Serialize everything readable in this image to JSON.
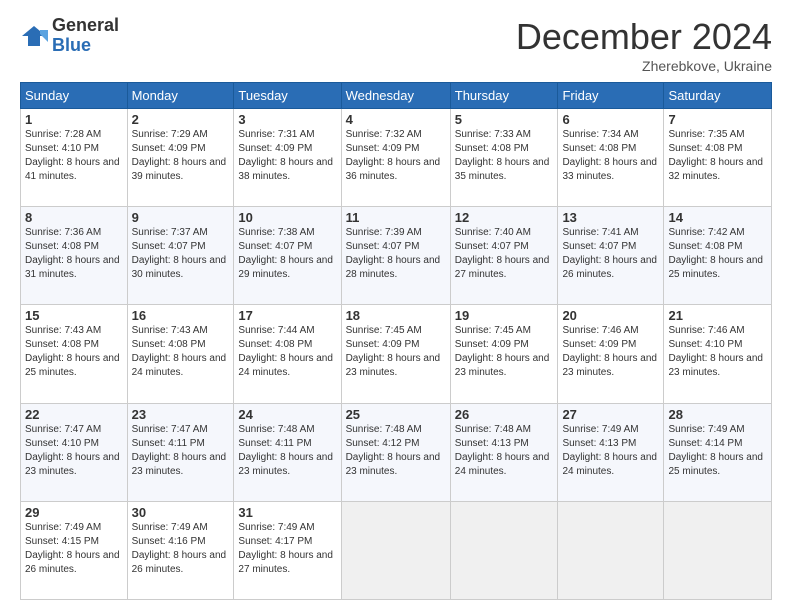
{
  "logo": {
    "general": "General",
    "blue": "Blue"
  },
  "title": "December 2024",
  "subtitle": "Zherebkove, Ukraine",
  "days_header": [
    "Sunday",
    "Monday",
    "Tuesday",
    "Wednesday",
    "Thursday",
    "Friday",
    "Saturday"
  ],
  "weeks": [
    [
      {
        "day": "1",
        "sunrise": "7:28 AM",
        "sunset": "4:10 PM",
        "daylight": "8 hours and 41 minutes."
      },
      {
        "day": "2",
        "sunrise": "7:29 AM",
        "sunset": "4:09 PM",
        "daylight": "8 hours and 39 minutes."
      },
      {
        "day": "3",
        "sunrise": "7:31 AM",
        "sunset": "4:09 PM",
        "daylight": "8 hours and 38 minutes."
      },
      {
        "day": "4",
        "sunrise": "7:32 AM",
        "sunset": "4:09 PM",
        "daylight": "8 hours and 36 minutes."
      },
      {
        "day": "5",
        "sunrise": "7:33 AM",
        "sunset": "4:08 PM",
        "daylight": "8 hours and 35 minutes."
      },
      {
        "day": "6",
        "sunrise": "7:34 AM",
        "sunset": "4:08 PM",
        "daylight": "8 hours and 33 minutes."
      },
      {
        "day": "7",
        "sunrise": "7:35 AM",
        "sunset": "4:08 PM",
        "daylight": "8 hours and 32 minutes."
      }
    ],
    [
      {
        "day": "8",
        "sunrise": "7:36 AM",
        "sunset": "4:08 PM",
        "daylight": "8 hours and 31 minutes."
      },
      {
        "day": "9",
        "sunrise": "7:37 AM",
        "sunset": "4:07 PM",
        "daylight": "8 hours and 30 minutes."
      },
      {
        "day": "10",
        "sunrise": "7:38 AM",
        "sunset": "4:07 PM",
        "daylight": "8 hours and 29 minutes."
      },
      {
        "day": "11",
        "sunrise": "7:39 AM",
        "sunset": "4:07 PM",
        "daylight": "8 hours and 28 minutes."
      },
      {
        "day": "12",
        "sunrise": "7:40 AM",
        "sunset": "4:07 PM",
        "daylight": "8 hours and 27 minutes."
      },
      {
        "day": "13",
        "sunrise": "7:41 AM",
        "sunset": "4:07 PM",
        "daylight": "8 hours and 26 minutes."
      },
      {
        "day": "14",
        "sunrise": "7:42 AM",
        "sunset": "4:08 PM",
        "daylight": "8 hours and 25 minutes."
      }
    ],
    [
      {
        "day": "15",
        "sunrise": "7:43 AM",
        "sunset": "4:08 PM",
        "daylight": "8 hours and 25 minutes."
      },
      {
        "day": "16",
        "sunrise": "7:43 AM",
        "sunset": "4:08 PM",
        "daylight": "8 hours and 24 minutes."
      },
      {
        "day": "17",
        "sunrise": "7:44 AM",
        "sunset": "4:08 PM",
        "daylight": "8 hours and 24 minutes."
      },
      {
        "day": "18",
        "sunrise": "7:45 AM",
        "sunset": "4:09 PM",
        "daylight": "8 hours and 23 minutes."
      },
      {
        "day": "19",
        "sunrise": "7:45 AM",
        "sunset": "4:09 PM",
        "daylight": "8 hours and 23 minutes."
      },
      {
        "day": "20",
        "sunrise": "7:46 AM",
        "sunset": "4:09 PM",
        "daylight": "8 hours and 23 minutes."
      },
      {
        "day": "21",
        "sunrise": "7:46 AM",
        "sunset": "4:10 PM",
        "daylight": "8 hours and 23 minutes."
      }
    ],
    [
      {
        "day": "22",
        "sunrise": "7:47 AM",
        "sunset": "4:10 PM",
        "daylight": "8 hours and 23 minutes."
      },
      {
        "day": "23",
        "sunrise": "7:47 AM",
        "sunset": "4:11 PM",
        "daylight": "8 hours and 23 minutes."
      },
      {
        "day": "24",
        "sunrise": "7:48 AM",
        "sunset": "4:11 PM",
        "daylight": "8 hours and 23 minutes."
      },
      {
        "day": "25",
        "sunrise": "7:48 AM",
        "sunset": "4:12 PM",
        "daylight": "8 hours and 23 minutes."
      },
      {
        "day": "26",
        "sunrise": "7:48 AM",
        "sunset": "4:13 PM",
        "daylight": "8 hours and 24 minutes."
      },
      {
        "day": "27",
        "sunrise": "7:49 AM",
        "sunset": "4:13 PM",
        "daylight": "8 hours and 24 minutes."
      },
      {
        "day": "28",
        "sunrise": "7:49 AM",
        "sunset": "4:14 PM",
        "daylight": "8 hours and 25 minutes."
      }
    ],
    [
      {
        "day": "29",
        "sunrise": "7:49 AM",
        "sunset": "4:15 PM",
        "daylight": "8 hours and 26 minutes."
      },
      {
        "day": "30",
        "sunrise": "7:49 AM",
        "sunset": "4:16 PM",
        "daylight": "8 hours and 26 minutes."
      },
      {
        "day": "31",
        "sunrise": "7:49 AM",
        "sunset": "4:17 PM",
        "daylight": "8 hours and 27 minutes."
      },
      null,
      null,
      null,
      null
    ]
  ]
}
